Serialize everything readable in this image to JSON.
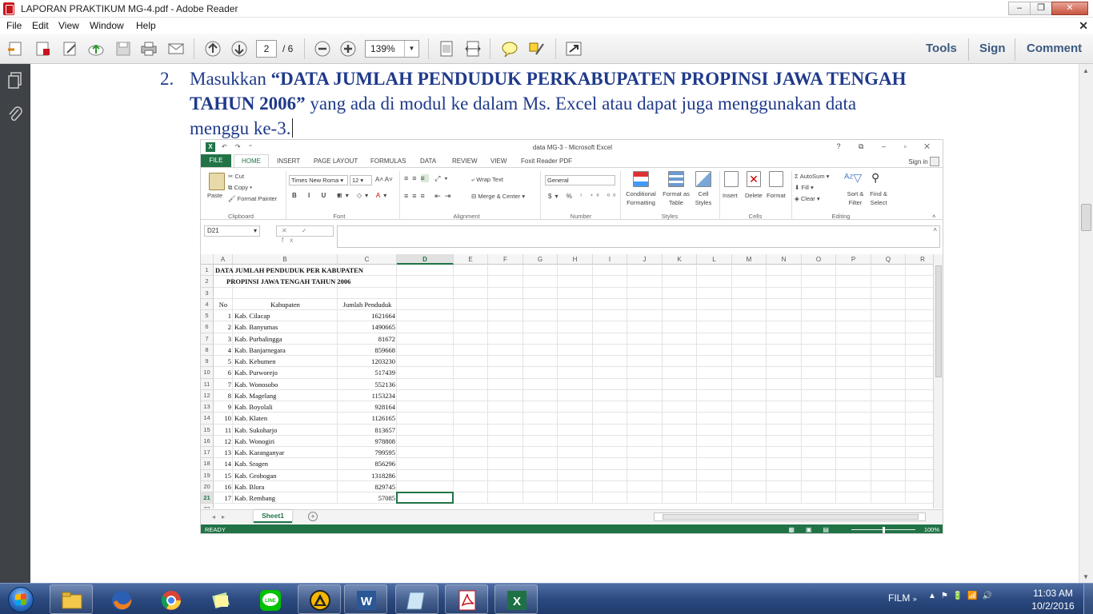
{
  "window": {
    "title": "LAPORAN PRAKTIKUM MG-4.pdf - Adobe Reader"
  },
  "menu": {
    "items": [
      "File",
      "Edit",
      "View",
      "Window",
      "Help"
    ]
  },
  "toolbar": {
    "current_page": "2",
    "total_pages": "/ 6",
    "zoom": "139%",
    "tools": "Tools",
    "sign": "Sign",
    "comment": "Comment"
  },
  "document": {
    "num": "2.",
    "text_pre": "Masukkan ",
    "text_bold": "“DATA JUMLAH PENDUDUK PERKABUPATEN PROPINSI JAWA TENGAH TAHUN 2006”",
    "text_post": " yang ada di modul ke dalam Ms. Excel atau dapat juga menggunakan data menggu ke-3."
  },
  "excel": {
    "title": "data MG-3 - Microsoft Excel",
    "qat": "↶ ↷ ⁼",
    "window_buttons": "? ⧉ – ▫ ✕",
    "signin": "Sign in",
    "tabs": [
      "FILE",
      "HOME",
      "INSERT",
      "PAGE LAYOUT",
      "FORMULAS",
      "DATA",
      "REVIEW",
      "VIEW",
      "Foxit Reader PDF"
    ],
    "ribbon": {
      "paste": "Paste",
      "cut": "Cut",
      "copy": "Copy",
      "format_painter": "Format Painter",
      "font_name": "Times New Roma",
      "font_size": "12",
      "wrap_text": "Wrap Text",
      "merge_center": "Merge & Center",
      "number_format": "General",
      "conditional_formatting": "Conditional Formatting",
      "format_as_table": "Format as Table",
      "cell_styles": "Cell Styles",
      "insert": "Insert",
      "delete": "Delete",
      "format": "Format",
      "autosum": "AutoSum",
      "fill": "Fill",
      "clear": "Clear",
      "sort_filter": "Sort & Filter",
      "find_select": "Find & Select",
      "groups": [
        "Clipboard",
        "Font",
        "Alignment",
        "Number",
        "Styles",
        "Cells",
        "Editing"
      ]
    },
    "name_box": "D21",
    "fx_buttons": "✕ ✓ fx",
    "columns": [
      "A",
      "B",
      "C",
      "D",
      "E",
      "F",
      "G",
      "H",
      "I",
      "J",
      "K",
      "L",
      "M",
      "N",
      "O",
      "P",
      "Q",
      "R"
    ],
    "selected_col": "D",
    "selected_row": "21",
    "heading1": "DATA JUMLAH PENDUDUK PER KABUPATEN",
    "heading2": "PROPINSI JAWA TENGAH TAHUN 2006",
    "header": {
      "no": "No",
      "kab": "Kabupaten",
      "jml": "Jumlah Penduduk"
    },
    "rows": [
      {
        "no": "1",
        "kab": "Kab. Cilacap",
        "jml": "1621664"
      },
      {
        "no": "2",
        "kab": "Kab. Banyumas",
        "jml": "1490665"
      },
      {
        "no": "3",
        "kab": "Kab. Purbalingga",
        "jml": "81672"
      },
      {
        "no": "4",
        "kab": "Kab. Banjarnegara",
        "jml": "859668"
      },
      {
        "no": "5",
        "kab": "Kab. Kebumen",
        "jml": "1203230"
      },
      {
        "no": "6",
        "kab": "Kab. Purworejo",
        "jml": "517439"
      },
      {
        "no": "7",
        "kab": "Kab. Wonosobo",
        "jml": "552136"
      },
      {
        "no": "8",
        "kab": "Kab. Magelang",
        "jml": "1153234"
      },
      {
        "no": "9",
        "kab": "Kab. Boyolali",
        "jml": "928164"
      },
      {
        "no": "10",
        "kab": "Kab. Klaten",
        "jml": "1126165"
      },
      {
        "no": "11",
        "kab": "Kab. Sukoharjo",
        "jml": "813657"
      },
      {
        "no": "12",
        "kab": "Kab. Wonogiri",
        "jml": "978808"
      },
      {
        "no": "13",
        "kab": "Kab. Karanganyar",
        "jml": "799595"
      },
      {
        "no": "14",
        "kab": "Kab. Sragen",
        "jml": "856296"
      },
      {
        "no": "15",
        "kab": "Kab. Grobogan",
        "jml": "1318286"
      },
      {
        "no": "16",
        "kab": "Kab. Blora",
        "jml": "829745"
      },
      {
        "no": "17",
        "kab": "Kab. Rembang",
        "jml": "57085"
      }
    ],
    "sheet": "Sheet1",
    "status": "READY",
    "zoom": "100%"
  },
  "taskbar": {
    "tray_label": "FILM",
    "time": "11:03 AM",
    "date": "10/2/2016"
  }
}
